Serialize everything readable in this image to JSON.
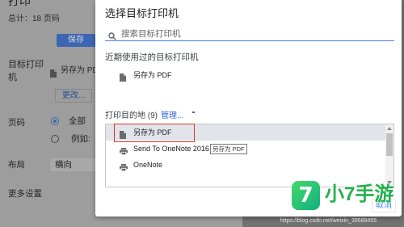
{
  "sidebar": {
    "title": "打印",
    "total": "总计：18 页码",
    "save_label": "保存",
    "destination_label": "目标打印机",
    "destination_value": "另存为 PDF",
    "change_label": "更改...",
    "pages_label": "页码",
    "pages_options": [
      {
        "label": "全部",
        "checked": true
      },
      {
        "label": "例如:",
        "checked": false
      }
    ],
    "layout_label": "布局",
    "layout_value": "横向",
    "more_settings_label": "更多设置"
  },
  "dialog": {
    "title": "选择目标打印机",
    "search_placeholder": "搜索目标打印机",
    "recent_heading": "近期使用过的目标打印机",
    "recent_items": [
      {
        "label": "另存为 PDF",
        "icon": "document-icon"
      }
    ],
    "destinations_heading": "打印目的地 (9)",
    "manage_label": "管理...",
    "destinations": [
      {
        "label": "另存为 PDF",
        "icon": "document-icon",
        "selected": true
      },
      {
        "label": "Send To OneNote 2016",
        "icon": "printer-icon",
        "selected": false
      },
      {
        "label": "OneNote",
        "icon": "printer-icon",
        "selected": false
      }
    ],
    "tooltip": "另存为 PDF",
    "cancel_label": "取消"
  },
  "watermark": {
    "logo_glyph": "7",
    "brand": "小7手游",
    "url": "https://blog.csdn.net/weixin_39589455"
  },
  "colors": {
    "accent": "#4285f4",
    "link": "#3367d6",
    "row_highlight": "#e1e4ea",
    "annotation": "#e0332b",
    "brand": "#23b14d",
    "dimmed_button": "#3d66b2"
  }
}
